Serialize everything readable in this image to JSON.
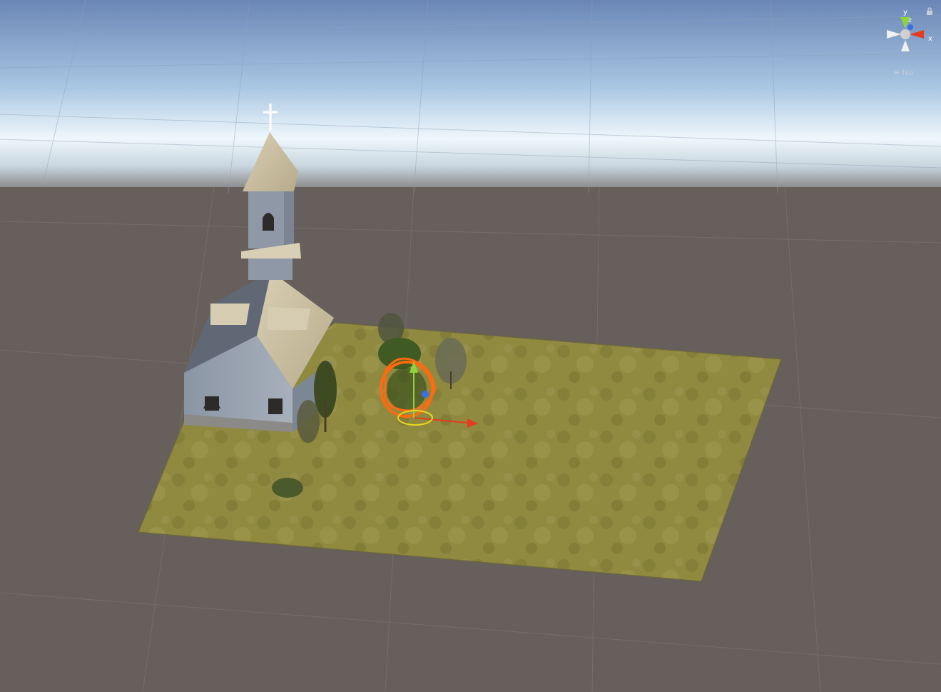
{
  "scene_view": {
    "projection_label": "Iso",
    "axis_labels": {
      "x": "x",
      "y": "y",
      "z": "z"
    },
    "colors": {
      "sky_top": "#6e8cbd",
      "sky_horizon": "#eaf4fb",
      "ground": "#675f5b",
      "grass": "#8f8a3e",
      "selection_outline": "#ff6a10",
      "axis_x": "#e53b1e",
      "axis_y": "#8dd43a",
      "axis_z": "#3a6ee5"
    },
    "objects": [
      "church",
      "bell-tower",
      "cross",
      "terrain-plane",
      "tree",
      "bush",
      "selected-tree"
    ]
  }
}
